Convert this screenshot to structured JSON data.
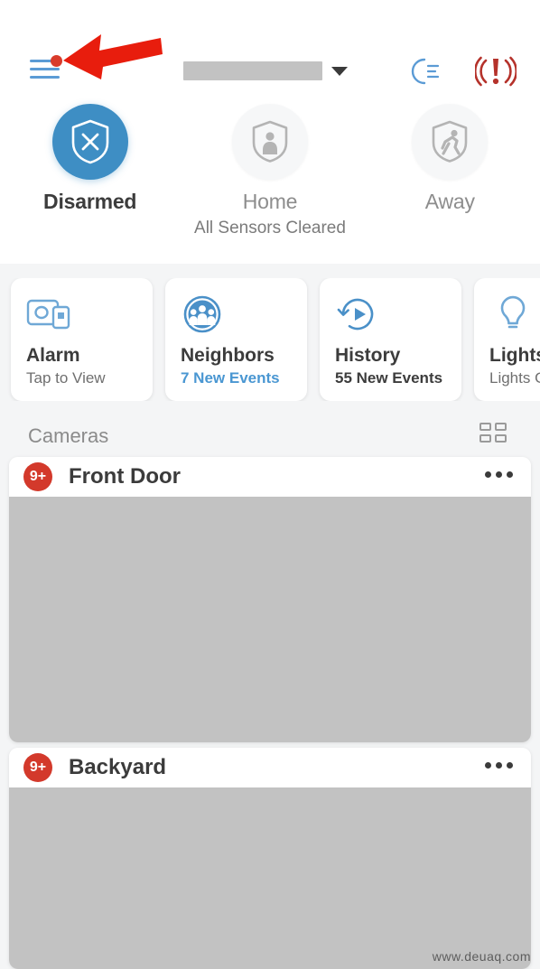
{
  "app": {
    "watermark": "www.deuaq.com"
  },
  "topbar": {
    "menu_icon": "hamburger-menu-icon",
    "menu_has_notification": true,
    "location_value": "",
    "location_placeholder": "",
    "dropdown_icon": "chevron-down-icon",
    "moon_icon": "moon-mode-icon",
    "alert_icon": "siren-alert-icon"
  },
  "modes": {
    "items": [
      {
        "id": "disarmed",
        "label": "Disarmed",
        "icon": "shield-x-icon",
        "active": true
      },
      {
        "id": "home",
        "label": "Home",
        "icon": "shield-person-icon",
        "active": false
      },
      {
        "id": "away",
        "label": "Away",
        "icon": "shield-running-icon",
        "active": false
      }
    ],
    "status": "All Sensors Cleared",
    "active_color": "#3e8ec4"
  },
  "quick_cards": [
    {
      "id": "alarm",
      "icon": "base-station-icon",
      "title": "Alarm",
      "sub": "Tap to View",
      "sub_style": "normal"
    },
    {
      "id": "neighbors",
      "icon": "neighbors-icon",
      "title": "Neighbors",
      "sub": "7 New Events",
      "sub_style": "accent"
    },
    {
      "id": "history",
      "icon": "history-icon",
      "title": "History",
      "sub": "55 New Events",
      "sub_style": "bold"
    },
    {
      "id": "lights",
      "icon": "lightbulb-icon",
      "title": "Lights",
      "sub": "Lights Off",
      "sub_style": "normal"
    }
  ],
  "cameras": {
    "section_title": "Cameras",
    "grid_icon": "grid-view-icon",
    "items": [
      {
        "id": "front-door",
        "name": "Front Door",
        "badge": "9+",
        "more_icon": "more-options-icon"
      },
      {
        "id": "backyard",
        "name": "Backyard",
        "badge": "9+",
        "more_icon": "more-options-icon"
      }
    ],
    "badge_color": "#d3392b"
  },
  "annotation": {
    "arrow_icon": "red-arrow-left",
    "arrow_color": "#e81d0d",
    "points_to": "hamburger-menu-icon"
  }
}
